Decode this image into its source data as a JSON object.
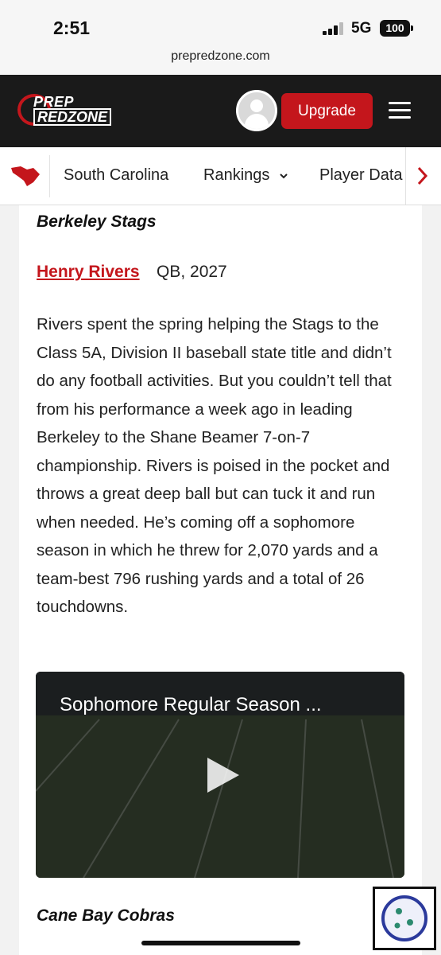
{
  "status": {
    "time": "2:51",
    "network": "5G",
    "battery": "100"
  },
  "browser": {
    "url": "prepredzone.com"
  },
  "header": {
    "logo_top": "PREP",
    "logo_bottom": "REDZONE",
    "upgrade_label": "Upgrade"
  },
  "subnav": {
    "items": [
      "South Carolina",
      "Rankings",
      "Player Data"
    ]
  },
  "article": {
    "team": "Berkeley Stags",
    "player_name": "Henry Rivers",
    "player_meta": "QB, 2027",
    "body": "Rivers spent the spring helping the Stags to the Class 5A, Division II baseball state title and didn’t do any football activities. But you couldn’t tell that from his performance a week ago in leading Berkeley to the Shane Beamer 7-on-7 championship. Rivers is poised in the pocket and throws a great deep ball but can tuck it and run when needed. He’s coming off a sophomore season in which he threw for 2,070 yards and a team-best 796 rushing yards and a total of 26 touchdowns.",
    "video_title": "Sophomore Regular Season ...",
    "next_team": "Cane Bay Cobras"
  },
  "colors": {
    "brand_red": "#c4161c",
    "header_bg": "#1a1a1a",
    "link": "#c4161c"
  },
  "icons": [
    "signal-icon",
    "battery-icon",
    "avatar-icon",
    "menu-icon",
    "south-carolina-icon",
    "chevron-down-icon",
    "chevron-right-icon",
    "play-icon",
    "cookie-icon"
  ]
}
